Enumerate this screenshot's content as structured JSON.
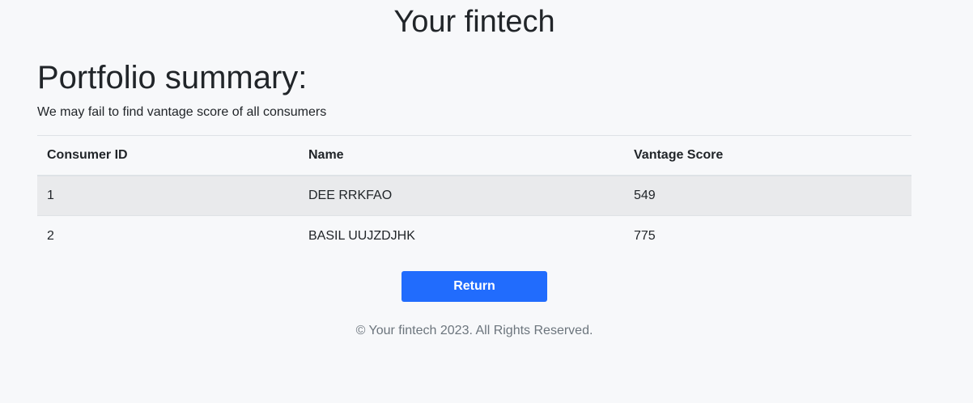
{
  "header": {
    "title": "Your fintech"
  },
  "main": {
    "heading": "Portfolio summary:",
    "note": "We may fail to find vantage score of all consumers",
    "table": {
      "columns": [
        "Consumer ID",
        "Name",
        "Vantage Score"
      ],
      "rows": [
        [
          "1",
          "DEE RRKFAO",
          "549"
        ],
        [
          "2",
          "BASIL UUJZDJHK",
          "775"
        ]
      ]
    },
    "return_label": "Return"
  },
  "footer": {
    "text": "© Your fintech 2023. All Rights Reserved."
  },
  "colors": {
    "accent": "#216cfd",
    "background": "#f7f8fa",
    "row_stripe": "#e9eaec"
  }
}
